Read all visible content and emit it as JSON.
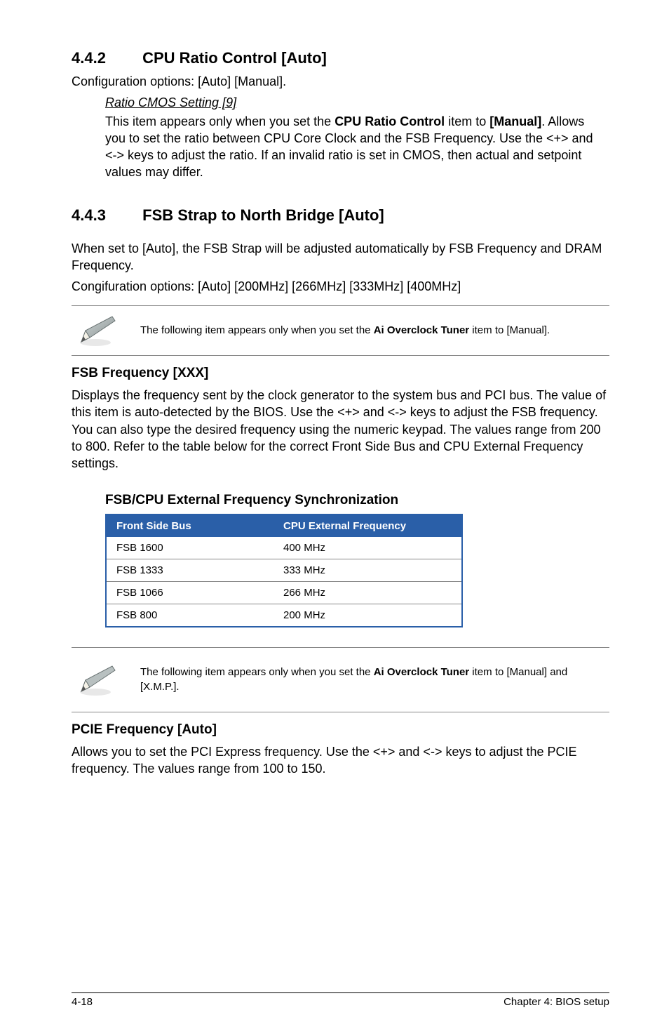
{
  "sections": {
    "cpu_ratio": {
      "number": "4.4.2",
      "title": "CPU Ratio Control [Auto]",
      "config_line": "Configuration options: [Auto] [Manual].",
      "sub_heading": "Ratio CMOS Setting [9]",
      "sub_body": "This item appears only when you set the CPU Ratio Control item to [Manual]. Allows you to set the ratio between CPU Core Clock and the FSB Frequency. Use the <+> and <-> keys to adjust the ratio. If an invalid ratio is set in CMOS, then actual and setpoint values may differ.",
      "sub_body_parts": {
        "p1": "This item appears only when you set the ",
        "b1": "CPU Ratio Control",
        "p2": " item to ",
        "b2": "[Manual]",
        "p3": ". Allows you to set the ratio between CPU Core Clock and the FSB Frequency. Use the <+> and <-> keys to adjust the ratio. If an invalid ratio is set in CMOS, then actual and setpoint values may differ."
      }
    },
    "fsb_strap": {
      "number": "4.4.3",
      "title": "FSB Strap to North Bridge [Auto]",
      "body1": "When set to [Auto], the FSB Strap will be adjusted automatically by FSB Frequency and DRAM Frequency.",
      "body2": "Congifuration options: [Auto] [200MHz] [266MHz] [333MHz] [400MHz]"
    },
    "note1": {
      "p1": "The following item appears only when you set the ",
      "b1": "Ai Overclock Tuner",
      "p2": " item to [Manual]."
    },
    "fsb_freq": {
      "title": "FSB Frequency [XXX]",
      "body": "Displays the frequency sent by the clock generator to the system bus and PCI bus. The value of this item is auto-detected by the BIOS. Use the <+> and <-> keys to adjust the FSB frequency. You can also type the desired frequency using the numeric keypad. The values range from 200 to 800. Refer to the table below for the correct Front Side Bus and CPU External Frequency settings."
    },
    "table_section": {
      "title": "FSB/CPU External Frequency Synchronization",
      "header1": "Front Side Bus",
      "header2": "CPU External Frequency",
      "rows": [
        {
          "c1": "FSB 1600",
          "c2": "400 MHz"
        },
        {
          "c1": "FSB 1333",
          "c2": "333 MHz"
        },
        {
          "c1": "FSB 1066",
          "c2": "266 MHz"
        },
        {
          "c1": "FSB 800",
          "c2": "200 MHz"
        }
      ]
    },
    "note2": {
      "p1": "The following item appears only when you set the ",
      "b1": "Ai Overclock Tuner",
      "p2": " item to [Manual] and [X.M.P.]."
    },
    "pcie": {
      "title": "PCIE Frequency [Auto]",
      "body": "Allows you to set the PCI Express frequency. Use the <+> and <-> keys to adjust the PCIE frequency. The values range from 100 to 150."
    }
  },
  "footer": {
    "left": "4-18",
    "right": "Chapter 4: BIOS setup"
  }
}
